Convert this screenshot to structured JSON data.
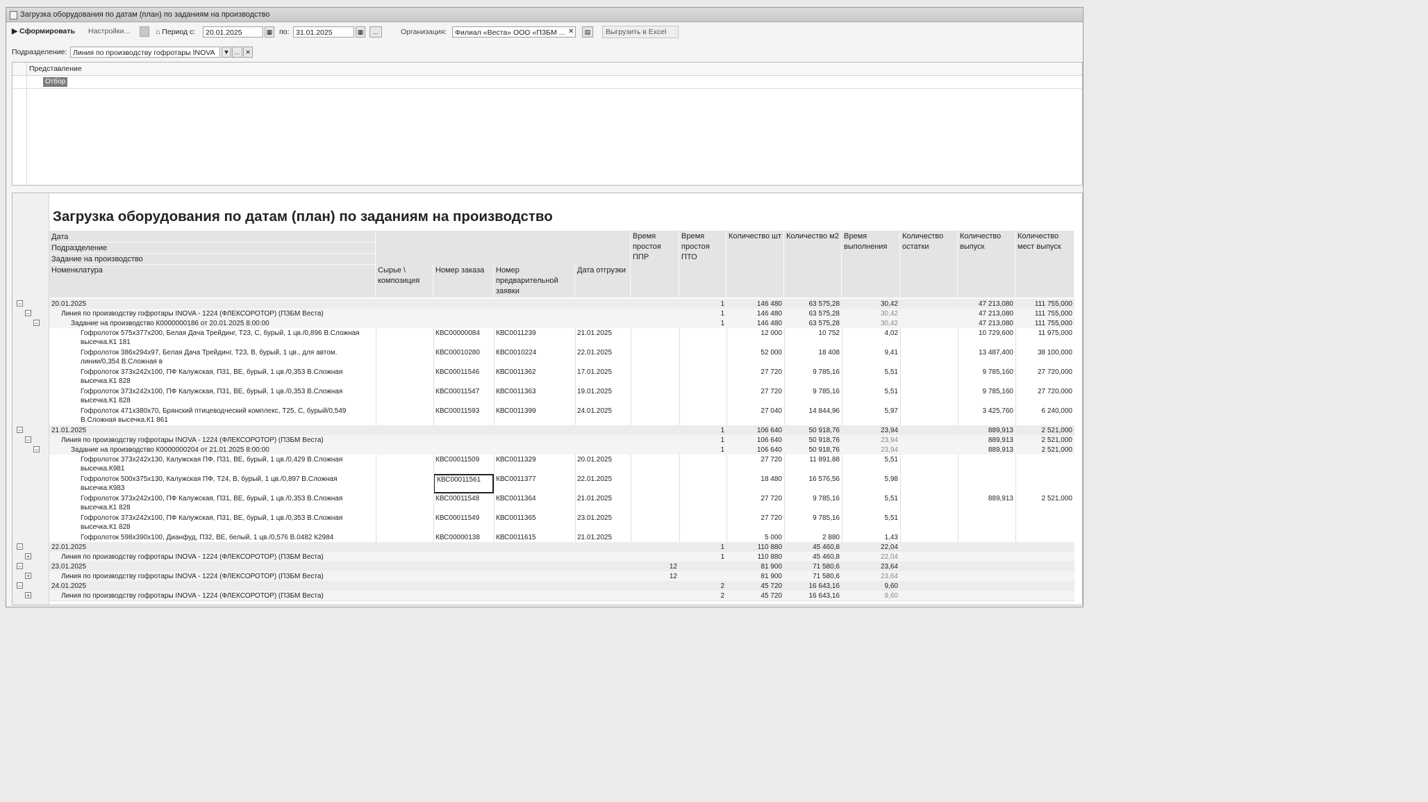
{
  "window": {
    "title": "Загрузка оборудования по датам (план) по заданиям на производство"
  },
  "toolbar": {
    "generate_label": "Сформировать",
    "settings_label": "Настройки...",
    "period_from_label": "Период с:",
    "period_from_value": "20.01.2025",
    "period_to_label": "по:",
    "period_to_value": "31.01.2025",
    "period_more": "...",
    "org_label": "Организация:",
    "org_value": "Филиал «Веста» ООО «ПЗБМ ...",
    "export_label": "Выгрузить в Excel"
  },
  "subdivision": {
    "label": "Подразделение:",
    "value": "Линия по производству гофротары INOVA -",
    "more": "..."
  },
  "filter_pane": {
    "header": "Представление",
    "selected": "Отбор"
  },
  "report": {
    "title": "Загрузка оборудования по датам (план) по заданиям на производство",
    "header": {
      "group_levels": [
        "Дата",
        "Подразделение",
        "Задание на производство",
        "Номенклатура"
      ],
      "sub": {
        "syr": "Сырье \\ композиция",
        "order": "Номер заказа",
        "prelim": "Номер предварительной заявки",
        "ship": "Дата отгрузки"
      },
      "metrics": {
        "ppr": "Время простоя ППР",
        "pto": "Время простоя ПТО",
        "qty": "Количество шт",
        "m2": "Количество м2",
        "time": "Время выполнения",
        "rest": "Количество остатки",
        "out": "Количество выпуск",
        "places": "Количество мест выпуск"
      }
    },
    "rows": [
      {
        "level": 0,
        "toggle": "−",
        "name": "20.01.2025",
        "ppr": "",
        "pto": "1",
        "qty": "146 480",
        "m2": "63 575,28",
        "time": "30,42",
        "rest": "",
        "out": "47 213,080",
        "places": "111 755,000"
      },
      {
        "level": 1,
        "toggle": "−",
        "name": "Линия по производству гофротары INOVA - 1224 (ФЛЕКСОРОТОР) (ПЗБМ Веста)",
        "ppr": "",
        "pto": "1",
        "qty": "146 480",
        "m2": "63 575,28",
        "time": "30,42",
        "rest": "",
        "out": "47 213,080",
        "places": "111 755,000"
      },
      {
        "level": 2,
        "toggle": "−",
        "name": "Задание на производство К0000000186 от 20.01.2025 8:00:00",
        "ppr": "",
        "pto": "1",
        "qty": "146 480",
        "m2": "63 575,28",
        "time": "30,42",
        "rest": "",
        "out": "47 213,080",
        "places": "111 755,000"
      },
      {
        "level": 3,
        "name": "Гофролоток 575x377x200, Белая Дача Трейдинг, Т23, С, бурый, 1 цв./0,896 В.Сложная",
        "name2": "высечка.К1 181",
        "order": "КВС00000084",
        "prelim": "КВС0011239",
        "ship": "21.01.2025",
        "qty": "12 000",
        "m2": "10 752",
        "time": "4,02",
        "out": "10 729,600",
        "places": "11 975,000"
      },
      {
        "level": 3,
        "name": "Гофролоток 386x294x97, Белая Дача Трейдинг, Т23, В, бурый, 1 цв., для автом.",
        "name2": "линии/0,354 В.Сложная в",
        "order": "КВС00010280",
        "prelim": "КВС0010224",
        "ship": "22.01.2025",
        "qty": "52 000",
        "m2": "18 408",
        "time": "9,41",
        "out": "13 487,400",
        "places": "38 100,000"
      },
      {
        "level": 3,
        "name": "Гофролоток 373x242x100, ПФ Калужская, П31, ВЕ, бурый, 1 цв./0,353 В.Сложная",
        "name2": "высечка.К1 828",
        "order": "КВС00011546",
        "prelim": "КВС0011362",
        "ship": "17.01.2025",
        "qty": "27 720",
        "m2": "9 785,16",
        "time": "5,51",
        "out": "9 785,160",
        "places": "27 720,000"
      },
      {
        "level": 3,
        "name": "Гофролоток 373x242x100, ПФ Калужская, П31, ВЕ, бурый, 1 цв./0,353 В.Сложная",
        "name2": "высечка.К1 828",
        "order": "КВС00011547",
        "prelim": "КВС0011363",
        "ship": "19.01.2025",
        "qty": "27 720",
        "m2": "9 785,16",
        "time": "5,51",
        "out": "9 785,160",
        "places": "27 720,000"
      },
      {
        "level": 3,
        "name": "Гофролоток 471x380x70, Брянский птицеводческий комплекс, Т25, С, бурый/0,549",
        "name2": "В.Сложная высечка.К1 861",
        "order": "КВС00011593",
        "prelim": "КВС0011399",
        "ship": "24.01.2025",
        "qty": "27 040",
        "m2": "14 844,96",
        "time": "5,97",
        "out": "3 425,760",
        "places": "6 240,000"
      },
      {
        "level": 0,
        "toggle": "−",
        "name": "21.01.2025",
        "pto": "1",
        "qty": "106 640",
        "m2": "50 918,76",
        "time": "23,94",
        "out": "889,913",
        "places": "2 521,000"
      },
      {
        "level": 1,
        "toggle": "−",
        "name": "Линия по производству гофротары INOVA - 1224 (ФЛЕКСОРОТОР) (ПЗБМ Веста)",
        "pto": "1",
        "qty": "106 640",
        "m2": "50 918,76",
        "time": "23,94",
        "out": "889,913",
        "places": "2 521,000"
      },
      {
        "level": 2,
        "toggle": "−",
        "name": "Задание на производство К0000000204 от 21.01.2025 8:00:00",
        "pto": "1",
        "qty": "106 640",
        "m2": "50 918,76",
        "time": "23,94",
        "out": "889,913",
        "places": "2 521,000"
      },
      {
        "level": 3,
        "name": "Гофролоток 373x242x130, Калужская ПФ, П31, ВЕ, бурый, 1 цв./0,429 В.Сложная",
        "name2": "высечка.К981",
        "order": "КВС00011509",
        "prelim": "КВС0011329",
        "ship": "20.01.2025",
        "qty": "27 720",
        "m2": "11 891,88",
        "time": "5,51"
      },
      {
        "level": 3,
        "name": "Гофролоток 500x375x130, Калужская ПФ, Т24, В, бурый, 1 цв./0,897 В.Сложная",
        "name2": "высечка.К983",
        "order": "КВС00011561",
        "prelim": "КВС0011377",
        "ship": "22.01.2025",
        "qty": "18 480",
        "m2": "16 576,56",
        "time": "5,98",
        "selected": true
      },
      {
        "level": 3,
        "name": "Гофролоток 373x242x100, ПФ Калужская, П31, ВЕ, бурый, 1 цв./0,353 В.Сложная",
        "name2": "высечка.К1 828",
        "order": "КВС00011548",
        "prelim": "КВС0011364",
        "ship": "21.01.2025",
        "qty": "27 720",
        "m2": "9 785,16",
        "time": "5,51",
        "out": "889,913",
        "places": "2 521,000"
      },
      {
        "level": 3,
        "name": "Гофролоток 373x242x100, ПФ Калужская, П31, ВЕ, бурый, 1 цв./0,353 В.Сложная",
        "name2": "высечка.К1 828",
        "order": "КВС00011549",
        "prelim": "КВС0011365",
        "ship": "23.01.2025",
        "qty": "27 720",
        "m2": "9 785,16",
        "time": "5,51"
      },
      {
        "level": 3,
        "name": "Гофролоток 598x390x100, Дианфуд, П32, ВЕ, белый, 1 цв./0,576 В.0482 К2984",
        "order": "КВС00000138",
        "prelim": "КВС0011615",
        "ship": "21.01.2025",
        "qty": "5 000",
        "m2": "2 880",
        "time": "1,43"
      },
      {
        "level": 0,
        "toggle": "−",
        "name": "22.01.2025",
        "pto": "1",
        "qty": "110 880",
        "m2": "45 460,8",
        "time": "22,04"
      },
      {
        "level": 1,
        "toggle": "+",
        "name": "Линия по производству гофротары INOVA - 1224 (ФЛЕКСОРОТОР) (ПЗБМ Веста)",
        "pto": "1",
        "qty": "110 880",
        "m2": "45 460,8",
        "time": "22,04"
      },
      {
        "level": 0,
        "toggle": "−",
        "name": "23.01.2025",
        "ppr": "12",
        "qty": "81 900",
        "m2": "71 580,6",
        "time": "23,64"
      },
      {
        "level": 1,
        "toggle": "+",
        "name": "Линия по производству гофротары INOVA - 1224 (ФЛЕКСОРОТОР) (ПЗБМ Веста)",
        "ppr": "12",
        "qty": "81 900",
        "m2": "71 580,6",
        "time": "23,64"
      },
      {
        "level": 0,
        "toggle": "−",
        "name": "24.01.2025",
        "pto": "2",
        "qty": "45 720",
        "m2": "16 643,16",
        "time": "9,60"
      },
      {
        "level": 1,
        "toggle": "+",
        "name": "Линия по производству гофротары INOVA - 1224 (ФЛЕКСОРОТОР) (ПЗБМ Веста)",
        "pto": "2",
        "qty": "45 720",
        "m2": "16 643,16",
        "time": "9,60"
      }
    ]
  }
}
